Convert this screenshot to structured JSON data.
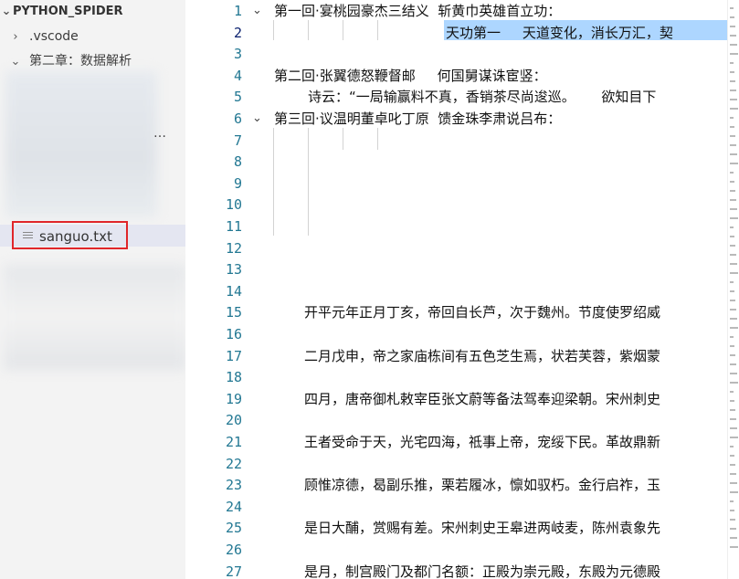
{
  "explorer": {
    "root_label": "PYTHON_SPIDER",
    "items": [
      {
        "label": ".vscode",
        "expanded": false
      },
      {
        "label": "第二章：数据解析",
        "expanded": true
      },
      {
        "label": "sanguo.txt",
        "selected": true
      }
    ],
    "truncated_hint": "…"
  },
  "editor": {
    "active_line": 2,
    "lines": [
      {
        "num": "1",
        "text": "第一回·宴桃园豪杰三结义  斩黄巾英雄首立功：",
        "foldable": true
      },
      {
        "num": "2",
        "text": "天功第一     天道变化，消长万汇，契",
        "foldable": false
      },
      {
        "num": "3",
        "text": "",
        "foldable": false
      },
      {
        "num": "4",
        "text": "第二回·张翼德怒鞭督邮     何国舅谋诛宦竖：",
        "foldable": false
      },
      {
        "num": "5",
        "text": "诗云：“一局输赢料不真，香销茶尽尚逡巡。      欲知目下",
        "foldable": false
      },
      {
        "num": "6",
        "text": "第三回·议温明董卓叱丁原  馈金珠李肃说吕布：",
        "foldable": true
      },
      {
        "num": "7",
        "text": "",
        "foldable": false
      },
      {
        "num": "8",
        "text": "",
        "foldable": false
      },
      {
        "num": "9",
        "text": "",
        "foldable": false
      },
      {
        "num": "10",
        "text": "",
        "foldable": false
      },
      {
        "num": "11",
        "text": "",
        "foldable": false
      },
      {
        "num": "12",
        "text": "",
        "foldable": false
      },
      {
        "num": "13",
        "text": "",
        "foldable": false
      },
      {
        "num": "14",
        "text": "",
        "foldable": false
      },
      {
        "num": "15",
        "text": "开平元年正月丁亥，帝回自长芦，次于魏州。节度使罗绍威",
        "foldable": false
      },
      {
        "num": "16",
        "text": "",
        "foldable": false
      },
      {
        "num": "17",
        "text": "二月戊申，帝之家庙栋间有五色芝生焉，状若芙蓉，紫烟蒙",
        "foldable": false
      },
      {
        "num": "18",
        "text": "",
        "foldable": false
      },
      {
        "num": "19",
        "text": "四月，唐帝御札敕宰臣张文蔚等备法驾奉迎梁朝。宋州刺史",
        "foldable": false
      },
      {
        "num": "20",
        "text": "",
        "foldable": false
      },
      {
        "num": "21",
        "text": "王者受命于天，光宅四海，祗事上帝，宠绥下民。革故鼎新",
        "foldable": false
      },
      {
        "num": "22",
        "text": "",
        "foldable": false
      },
      {
        "num": "23",
        "text": "顾惟凉德，曷副乐推，栗若履冰，懔如驭朽。金行启祚，玉",
        "foldable": false
      },
      {
        "num": "24",
        "text": "",
        "foldable": false
      },
      {
        "num": "25",
        "text": "是日大酺，赏赐有差。宋州刺史王皋进两岐麦，陈州袁象先",
        "foldable": false
      },
      {
        "num": "26",
        "text": "",
        "foldable": false
      },
      {
        "num": "27",
        "text": "是月，制宫殿门及都门名额：正殿为崇元殿，东殿为元德殿",
        "foldable": false
      }
    ]
  },
  "icons": {
    "chevron_right": "chevron-right-icon",
    "chevron_down": "chevron-down-icon",
    "file": "text-file-icon"
  },
  "colors": {
    "sidebar_bg": "#f3f3f3",
    "selection": "#add6ff",
    "line_number": "#237893",
    "highlight_box": "#e0262a"
  }
}
